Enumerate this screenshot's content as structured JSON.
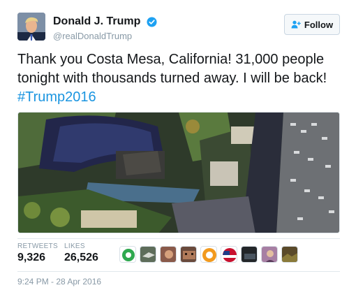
{
  "user": {
    "display_name": "Donald J. Trump",
    "handle": "@realDonaldTrump",
    "verified": true
  },
  "follow_button": {
    "label": "Follow"
  },
  "tweet": {
    "text": "Thank you Costa Mesa, California! 31,000 people tonight with thousands turned away. I will be back! ",
    "hashtag": "#Trump2016"
  },
  "media": {
    "type": "photo"
  },
  "stats": {
    "retweets_label": "RETWEETS",
    "retweets_value": "9,326",
    "likes_label": "LIKES",
    "likes_value": "26,526"
  },
  "liker_avatars": [
    "green-circle",
    "bird",
    "face",
    "group",
    "orange-circle",
    "flag",
    "dark-photo",
    "person",
    "landscape"
  ],
  "timestamp": "9:24 PM - 28 Apr 2016",
  "colors": {
    "link": "#1b95e0",
    "verified": "#1da1f2",
    "muted": "#8899a6"
  }
}
